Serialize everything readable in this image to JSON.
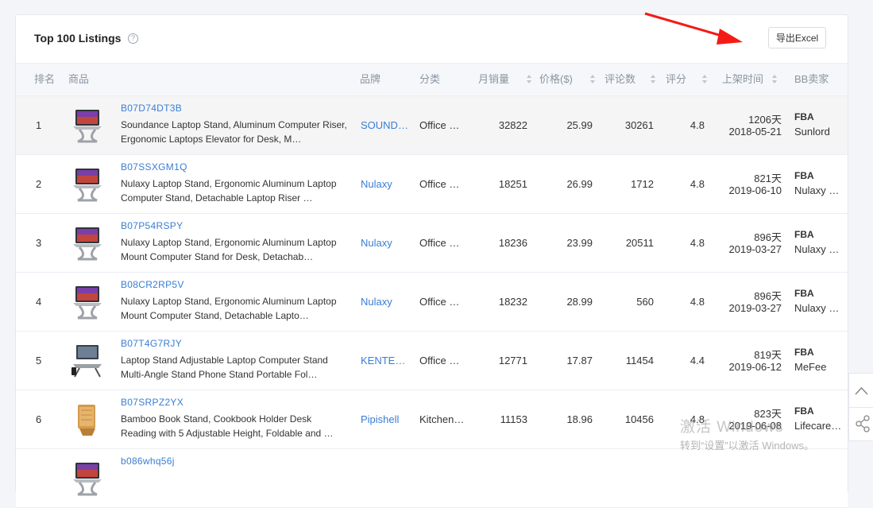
{
  "header": {
    "title": "Top 100 Listings",
    "help_icon": "question-circle-icon",
    "export_label": "导出Excel"
  },
  "columns": {
    "rank": "排名",
    "product": "商品",
    "brand": "品牌",
    "category": "分类",
    "sales": "月销量",
    "price": "价格($)",
    "reviews": "评论数",
    "rating": "评分",
    "listed": "上架时间",
    "seller": "BB卖家"
  },
  "rows": [
    {
      "rank": "1",
      "asin": "B07D74DT3B",
      "title": "Soundance Laptop Stand, Aluminum Computer Riser, Ergonomic Laptops Elevator for Desk, M…",
      "brand": "SOUND…",
      "category": "Office …",
      "sales": "32822",
      "price": "25.99",
      "reviews": "30261",
      "rating": "4.8",
      "days": "1206天",
      "date": "2018-05-21",
      "fulfillment": "FBA",
      "seller": "Sunlord",
      "image": "laptop-on-stand"
    },
    {
      "rank": "2",
      "asin": "B07SSXGM1Q",
      "title": "Nulaxy Laptop Stand, Ergonomic Aluminum Laptop Computer Stand, Detachable Laptop Riser …",
      "brand": "Nulaxy",
      "category": "Office …",
      "sales": "18251",
      "price": "26.99",
      "reviews": "1712",
      "rating": "4.8",
      "days": "821天",
      "date": "2019-06-10",
      "fulfillment": "FBA",
      "seller": "Nulaxy …",
      "image": "laptop-on-stand"
    },
    {
      "rank": "3",
      "asin": "B07P54RSPY",
      "title": "Nulaxy Laptop Stand, Ergonomic Aluminum Laptop Mount Computer Stand for Desk, Detachab…",
      "brand": "Nulaxy",
      "category": "Office …",
      "sales": "18236",
      "price": "23.99",
      "reviews": "20511",
      "rating": "4.8",
      "days": "896天",
      "date": "2019-03-27",
      "fulfillment": "FBA",
      "seller": "Nulaxy …",
      "image": "laptop-on-stand"
    },
    {
      "rank": "4",
      "asin": "B08CR2RP5V",
      "title": "Nulaxy Laptop Stand, Ergonomic Aluminum Laptop Mount Computer Stand, Detachable Lapto…",
      "brand": "Nulaxy",
      "category": "Office …",
      "sales": "18232",
      "price": "28.99",
      "reviews": "560",
      "rating": "4.8",
      "days": "896天",
      "date": "2019-03-27",
      "fulfillment": "FBA",
      "seller": "Nulaxy …",
      "image": "laptop-on-stand"
    },
    {
      "rank": "5",
      "asin": "B07T4G7RJY",
      "title": "Laptop Stand Adjustable Laptop Computer Stand Multi-Angle Stand Phone Stand Portable Fol…",
      "brand": "KENTE…",
      "category": "Office …",
      "sales": "12771",
      "price": "17.87",
      "reviews": "11454",
      "rating": "4.4",
      "days": "819天",
      "date": "2019-06-12",
      "fulfillment": "FBA",
      "seller": "MeFee",
      "image": "adjustable-stand"
    },
    {
      "rank": "6",
      "asin": "B07SRPZ2YX",
      "title": "Bamboo Book Stand, Cookbook Holder Desk Reading with 5 Adjustable Height, Foldable and …",
      "brand": "Pipishell",
      "category": "Kitchen…",
      "sales": "11153",
      "price": "18.96",
      "reviews": "10456",
      "rating": "4.8",
      "days": "823天",
      "date": "2019-06-08",
      "fulfillment": "FBA",
      "seller": "Lifecare…",
      "image": "bamboo-stand"
    },
    {
      "rank": "",
      "asin": "b086whq56j",
      "title": "",
      "brand": "",
      "category": "",
      "sales": "",
      "price": "",
      "reviews": "",
      "rating": "",
      "days": "",
      "date": "",
      "fulfillment": "",
      "seller": "",
      "image": "laptop-on-stand"
    }
  ],
  "side": {
    "top_icon": "chevron-up-icon",
    "share_icon": "share-icon"
  },
  "watermark": {
    "line1": "激活 Windows",
    "line2": "转到“设置”以激活 Windows。"
  },
  "annotation": {
    "arrow_color": "#f41b16"
  }
}
